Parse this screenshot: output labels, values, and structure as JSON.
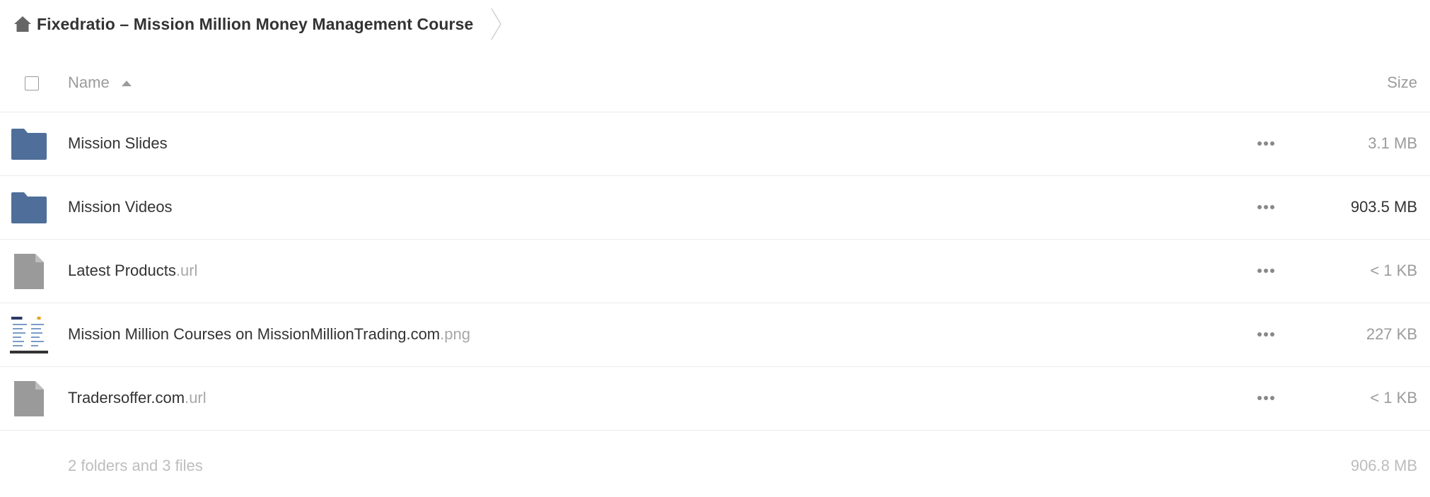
{
  "breadcrumb": {
    "home_icon": "home-icon",
    "title": "Fixedratio – Mission Million Money Management Course"
  },
  "header": {
    "name_label": "Name",
    "size_label": "Size",
    "sort_icon": "sort-ascending-icon"
  },
  "rows": [
    {
      "type": "folder",
      "icon": "folder-icon",
      "name": "Mission Slides",
      "ext": "",
      "size": "3.1 MB"
    },
    {
      "type": "folder",
      "icon": "folder-icon",
      "name": "Mission Videos",
      "ext": "",
      "size": "903.5 MB"
    },
    {
      "type": "file",
      "icon": "file-icon",
      "name": "Latest Products",
      "ext": ".url",
      "size": "< 1 KB"
    },
    {
      "type": "image",
      "icon": "image-thumbnail",
      "name": "Mission Million Courses on MissionMillionTrading.com",
      "ext": ".png",
      "size": "227 KB"
    },
    {
      "type": "file",
      "icon": "file-icon",
      "name": "Tradersoffer.com",
      "ext": ".url",
      "size": "< 1 KB"
    }
  ],
  "summary": {
    "text": "2 folders and 3 files",
    "total_size": "906.8 MB"
  },
  "colors": {
    "folder": "#4f6e99",
    "file": "#9a9a9a",
    "border": "#ececec"
  }
}
